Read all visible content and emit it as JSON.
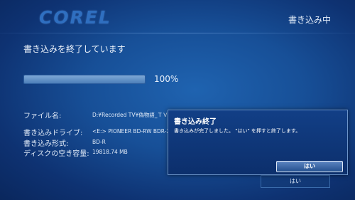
{
  "header": {
    "logo": "COREL",
    "status": "書き込み中"
  },
  "main": {
    "heading": "書き込みを終了しています",
    "progress": {
      "value": 1.0,
      "label": "100%"
    },
    "info": [
      {
        "label": "ファイル名:",
        "value": "D:¥Recorded TV¥偽物語_ＴＶ○○○○○○○○○○○"
      },
      {
        "label": "書き込みドライブ:",
        "value": "<E:> PIONEER BD-RW  BDR-20"
      },
      {
        "label": "書き込み形式:",
        "value": "BD-R"
      },
      {
        "label": "ディスクの空き容量:",
        "value": "19818.74 MB"
      }
    ],
    "under_button": "はい"
  },
  "dialog": {
    "title": "書き込み終了",
    "message": "書き込みが完了しました。 \"はい\" を押すと終了します。",
    "button": "はい"
  }
}
